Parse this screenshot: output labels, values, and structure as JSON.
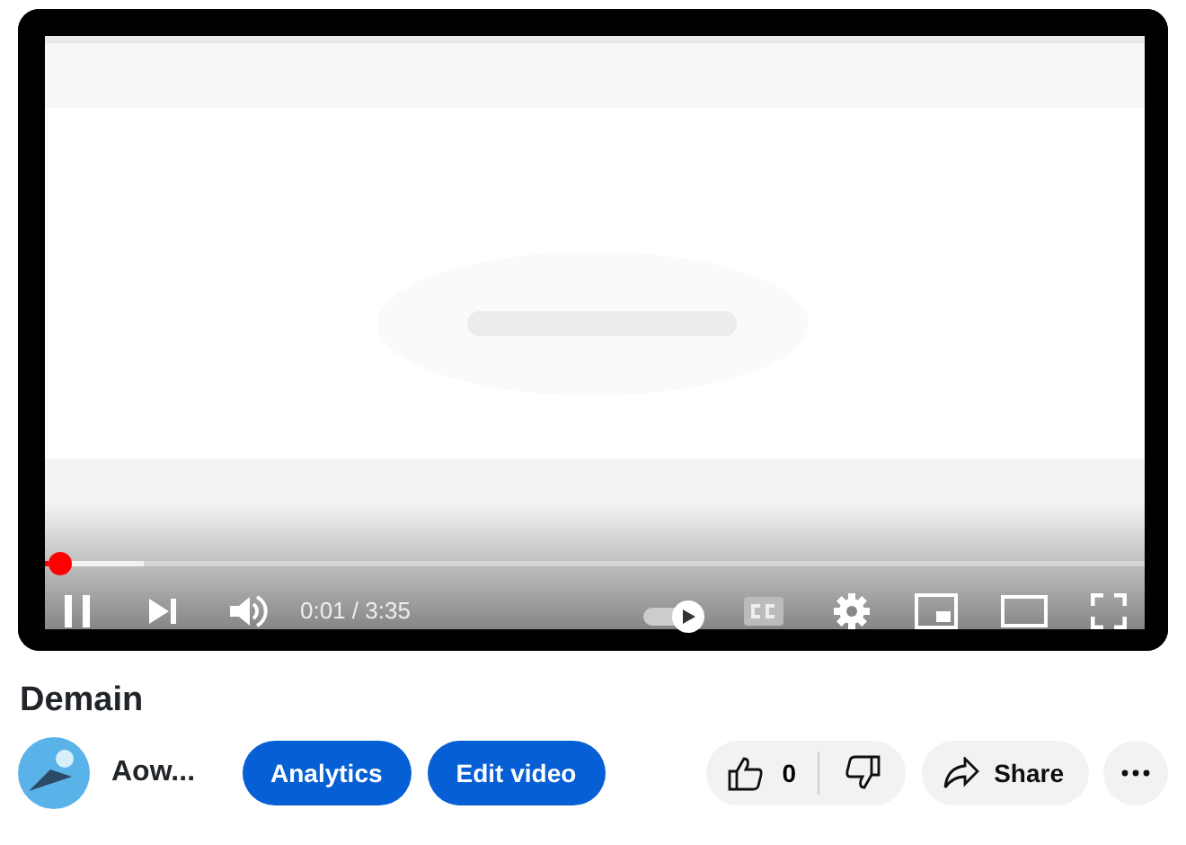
{
  "player": {
    "progress": {
      "level": 0.004
    },
    "time": "0:01 / 3:35",
    "controls": {
      "playing": true,
      "autoplay": {
        "on": true
      }
    }
  },
  "video": {
    "title": "Demain"
  },
  "channel": {
    "name": "Aow..."
  },
  "buttons": [
    "Analytics",
    "Edit video"
  ],
  "actions": {
    "likes": "0",
    "share": "Share"
  }
}
